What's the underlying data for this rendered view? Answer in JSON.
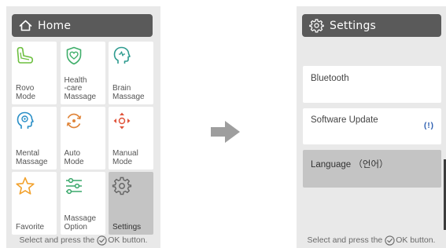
{
  "home": {
    "title": "Home",
    "title_icon": "home-icon",
    "tiles": [
      {
        "label": "Rovo\nMode",
        "icon": "rovo-seat-icon",
        "color": "#6cbf3f"
      },
      {
        "label": "Health\n-care\nMassage",
        "icon": "heart-shield-icon",
        "color": "#3fae6a"
      },
      {
        "label": "Brain\nMassage",
        "icon": "brain-head-icon",
        "color": "#2e9b8f"
      },
      {
        "label": "Mental\nMassage",
        "icon": "mental-head-icon",
        "color": "#2a8fc7"
      },
      {
        "label": "Auto\nMode",
        "icon": "auto-cycle-icon",
        "color": "#e0853a"
      },
      {
        "label": "Manual\nMode",
        "icon": "manual-arrows-icon",
        "color": "#e0533a"
      },
      {
        "label": "Favorite",
        "icon": "star-icon",
        "color": "#f2a12c"
      },
      {
        "label": "Massage\nOption",
        "icon": "sliders-icon",
        "color": "#3aa86b"
      },
      {
        "label": "Settings",
        "icon": "gear-icon",
        "color": "#666666",
        "selected": true
      }
    ],
    "footer": {
      "before": "Select and press the",
      "after": "OK button."
    }
  },
  "settings": {
    "title": "Settings",
    "title_icon": "gear-icon",
    "items": [
      {
        "label": "Bluetooth"
      },
      {
        "label": "Software Update",
        "badge": "(!)"
      },
      {
        "label": "Language （언어）",
        "selected": true
      }
    ],
    "footer": {
      "before": "Select and press the",
      "after": "OK button."
    }
  },
  "colors": {
    "title_bar": "#5a5a5a",
    "screen_bg": "#e9e9e9",
    "selected_bg": "#c4c4c4",
    "arrow": "#9e9e9e",
    "badge": "#2a5db0"
  }
}
